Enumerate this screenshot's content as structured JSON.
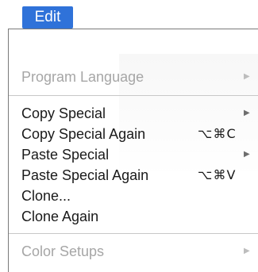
{
  "menu_title": "Edit",
  "items": [
    {
      "label": "Program Language",
      "shortcut": "",
      "arrow": "▶",
      "disabled": true
    },
    {
      "label": "Copy Special",
      "shortcut": "",
      "arrow": "▶",
      "disabled": false
    },
    {
      "label": "Copy Special Again",
      "shortcut": "⌥⌘C",
      "arrow": "",
      "disabled": false
    },
    {
      "label": "Paste Special",
      "shortcut": "",
      "arrow": "▶",
      "disabled": false
    },
    {
      "label": "Paste Special Again",
      "shortcut": "⌥⌘V",
      "arrow": "",
      "disabled": false
    },
    {
      "label": "Clone...",
      "shortcut": "",
      "arrow": "",
      "disabled": false
    },
    {
      "label": "Clone Again",
      "shortcut": "",
      "arrow": "",
      "disabled": false
    },
    {
      "label": "Color Setups",
      "shortcut": "",
      "arrow": "▶",
      "disabled": true
    }
  ],
  "colors": {
    "accent": "#2f72d9",
    "enabled_text": "#1a1a1a",
    "disabled_text": "#a6a6a6"
  }
}
